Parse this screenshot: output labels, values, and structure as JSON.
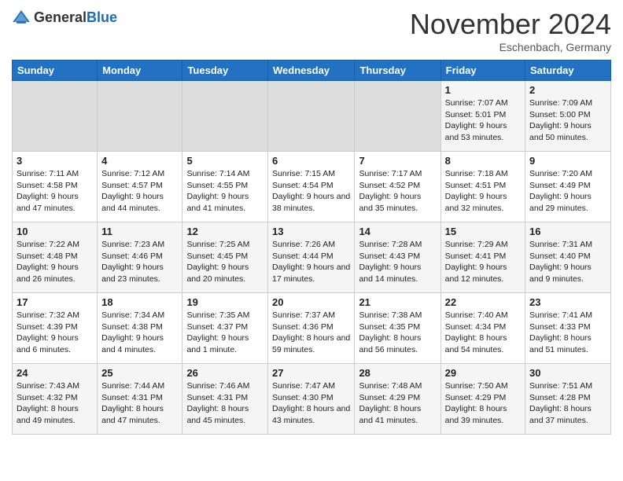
{
  "header": {
    "logo_general": "General",
    "logo_blue": "Blue",
    "title": "November 2024",
    "location": "Eschenbach, Germany"
  },
  "weekdays": [
    "Sunday",
    "Monday",
    "Tuesday",
    "Wednesday",
    "Thursday",
    "Friday",
    "Saturday"
  ],
  "weeks": [
    [
      {
        "day": "",
        "detail": ""
      },
      {
        "day": "",
        "detail": ""
      },
      {
        "day": "",
        "detail": ""
      },
      {
        "day": "",
        "detail": ""
      },
      {
        "day": "",
        "detail": ""
      },
      {
        "day": "1",
        "detail": "Sunrise: 7:07 AM\nSunset: 5:01 PM\nDaylight: 9 hours and 53 minutes."
      },
      {
        "day": "2",
        "detail": "Sunrise: 7:09 AM\nSunset: 5:00 PM\nDaylight: 9 hours and 50 minutes."
      }
    ],
    [
      {
        "day": "3",
        "detail": "Sunrise: 7:11 AM\nSunset: 4:58 PM\nDaylight: 9 hours and 47 minutes."
      },
      {
        "day": "4",
        "detail": "Sunrise: 7:12 AM\nSunset: 4:57 PM\nDaylight: 9 hours and 44 minutes."
      },
      {
        "day": "5",
        "detail": "Sunrise: 7:14 AM\nSunset: 4:55 PM\nDaylight: 9 hours and 41 minutes."
      },
      {
        "day": "6",
        "detail": "Sunrise: 7:15 AM\nSunset: 4:54 PM\nDaylight: 9 hours and 38 minutes."
      },
      {
        "day": "7",
        "detail": "Sunrise: 7:17 AM\nSunset: 4:52 PM\nDaylight: 9 hours and 35 minutes."
      },
      {
        "day": "8",
        "detail": "Sunrise: 7:18 AM\nSunset: 4:51 PM\nDaylight: 9 hours and 32 minutes."
      },
      {
        "day": "9",
        "detail": "Sunrise: 7:20 AM\nSunset: 4:49 PM\nDaylight: 9 hours and 29 minutes."
      }
    ],
    [
      {
        "day": "10",
        "detail": "Sunrise: 7:22 AM\nSunset: 4:48 PM\nDaylight: 9 hours and 26 minutes."
      },
      {
        "day": "11",
        "detail": "Sunrise: 7:23 AM\nSunset: 4:46 PM\nDaylight: 9 hours and 23 minutes."
      },
      {
        "day": "12",
        "detail": "Sunrise: 7:25 AM\nSunset: 4:45 PM\nDaylight: 9 hours and 20 minutes."
      },
      {
        "day": "13",
        "detail": "Sunrise: 7:26 AM\nSunset: 4:44 PM\nDaylight: 9 hours and 17 minutes."
      },
      {
        "day": "14",
        "detail": "Sunrise: 7:28 AM\nSunset: 4:43 PM\nDaylight: 9 hours and 14 minutes."
      },
      {
        "day": "15",
        "detail": "Sunrise: 7:29 AM\nSunset: 4:41 PM\nDaylight: 9 hours and 12 minutes."
      },
      {
        "day": "16",
        "detail": "Sunrise: 7:31 AM\nSunset: 4:40 PM\nDaylight: 9 hours and 9 minutes."
      }
    ],
    [
      {
        "day": "17",
        "detail": "Sunrise: 7:32 AM\nSunset: 4:39 PM\nDaylight: 9 hours and 6 minutes."
      },
      {
        "day": "18",
        "detail": "Sunrise: 7:34 AM\nSunset: 4:38 PM\nDaylight: 9 hours and 4 minutes."
      },
      {
        "day": "19",
        "detail": "Sunrise: 7:35 AM\nSunset: 4:37 PM\nDaylight: 9 hours and 1 minute."
      },
      {
        "day": "20",
        "detail": "Sunrise: 7:37 AM\nSunset: 4:36 PM\nDaylight: 8 hours and 59 minutes."
      },
      {
        "day": "21",
        "detail": "Sunrise: 7:38 AM\nSunset: 4:35 PM\nDaylight: 8 hours and 56 minutes."
      },
      {
        "day": "22",
        "detail": "Sunrise: 7:40 AM\nSunset: 4:34 PM\nDaylight: 8 hours and 54 minutes."
      },
      {
        "day": "23",
        "detail": "Sunrise: 7:41 AM\nSunset: 4:33 PM\nDaylight: 8 hours and 51 minutes."
      }
    ],
    [
      {
        "day": "24",
        "detail": "Sunrise: 7:43 AM\nSunset: 4:32 PM\nDaylight: 8 hours and 49 minutes."
      },
      {
        "day": "25",
        "detail": "Sunrise: 7:44 AM\nSunset: 4:31 PM\nDaylight: 8 hours and 47 minutes."
      },
      {
        "day": "26",
        "detail": "Sunrise: 7:46 AM\nSunset: 4:31 PM\nDaylight: 8 hours and 45 minutes."
      },
      {
        "day": "27",
        "detail": "Sunrise: 7:47 AM\nSunset: 4:30 PM\nDaylight: 8 hours and 43 minutes."
      },
      {
        "day": "28",
        "detail": "Sunrise: 7:48 AM\nSunset: 4:29 PM\nDaylight: 8 hours and 41 minutes."
      },
      {
        "day": "29",
        "detail": "Sunrise: 7:50 AM\nSunset: 4:29 PM\nDaylight: 8 hours and 39 minutes."
      },
      {
        "day": "30",
        "detail": "Sunrise: 7:51 AM\nSunset: 4:28 PM\nDaylight: 8 hours and 37 minutes."
      }
    ]
  ]
}
